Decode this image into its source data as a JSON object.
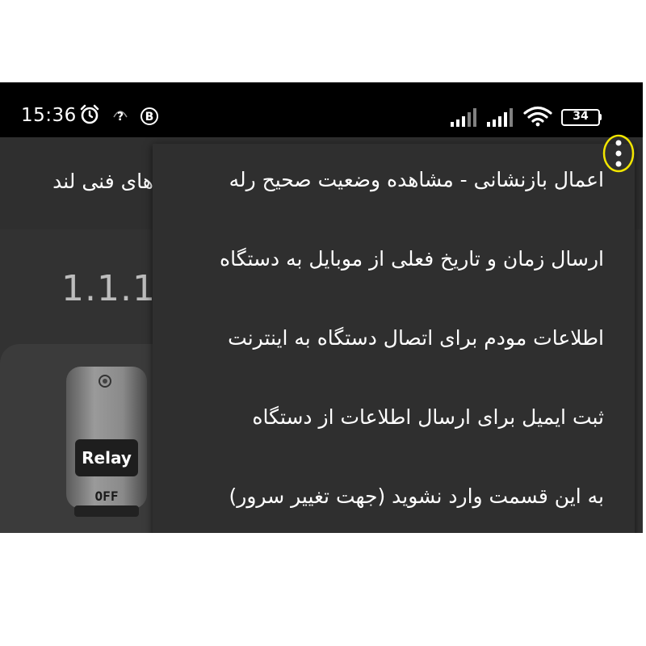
{
  "status_bar": {
    "time": "15:36",
    "icons": [
      "alarm-icon",
      "help-icon",
      "b-badge-icon",
      "signal-icon",
      "signal-icon",
      "wifi-icon",
      "battery-icon"
    ],
    "battery_level": "34"
  },
  "app_bar": {
    "title": "های فنی لند"
  },
  "content": {
    "version": "1.1.1",
    "relay_label": "Relay",
    "relay_state": "OFF"
  },
  "menu": {
    "items": [
      {
        "label": "اعمال بازنشانی - مشاهده وضعیت صحیح رله"
      },
      {
        "label": "ارسال زمان و تاریخ فعلی از موبایل به دستگاه"
      },
      {
        "label": "اطلاعات مودم برای اتصال دستگاه به اینترنت"
      },
      {
        "label": "ثبت ایمیل برای ارسال اطلاعات از دستگاه"
      },
      {
        "label": "به این قسمت وارد نشوید (جهت تغییر سرور)"
      }
    ]
  },
  "colors": {
    "status_bar_bg": "#000000",
    "app_bg": "#2c2c2c",
    "menu_bg": "#2f2f2f",
    "highlight_ring": "#f2e600"
  }
}
